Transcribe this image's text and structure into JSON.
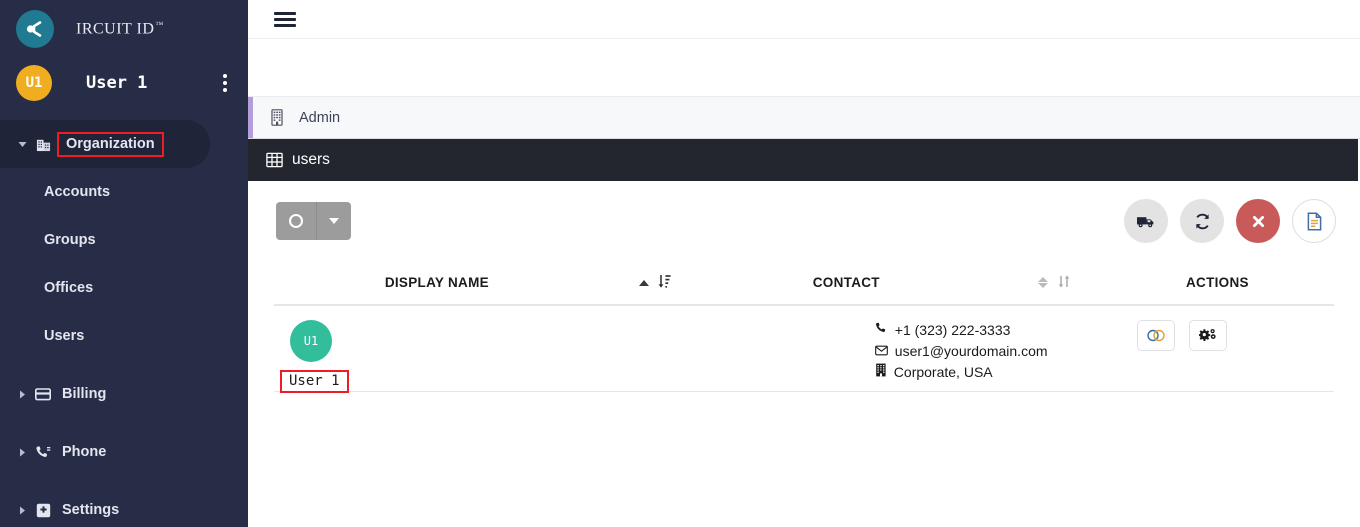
{
  "brand": {
    "name": "IRCUIT ID",
    "trademark": "™",
    "logo_icon": "circuit-logo-icon"
  },
  "sidebar": {
    "user": {
      "initials": "U1",
      "name": "User 1",
      "menu_icon": "kebab-menu-icon"
    },
    "items": [
      {
        "label": "Organization",
        "icon": "organization-icon",
        "expandable": true,
        "expanded": true,
        "active": true,
        "highlighted": true
      },
      {
        "label": "Accounts",
        "icon": "",
        "sub": true
      },
      {
        "label": "Groups",
        "icon": "",
        "sub": true
      },
      {
        "label": "Offices",
        "icon": "",
        "sub": true
      },
      {
        "label": "Users",
        "icon": "",
        "sub": true
      },
      {
        "label": "Billing",
        "icon": "credit-card-icon",
        "expandable": true,
        "expanded": false
      },
      {
        "label": "Phone",
        "icon": "phone-icon",
        "expandable": true,
        "expanded": false
      },
      {
        "label": "Settings",
        "icon": "settings-gear-icon",
        "expandable": true,
        "expanded": false
      }
    ]
  },
  "topbar": {
    "menu_toggle_icon": "hamburger-icon"
  },
  "breadcrumb": {
    "icon": "building-icon",
    "label": "Admin",
    "accent_color": "#b39ddb"
  },
  "panel": {
    "icon": "table-grid-icon",
    "title": "users"
  },
  "toolbar": {
    "split_button": {
      "main_icon": "circle-outline-icon",
      "caret_icon": "chevron-down-icon"
    },
    "actions": [
      {
        "name": "truck-icon",
        "style": "grey"
      },
      {
        "name": "refresh-icon",
        "style": "grey"
      },
      {
        "name": "close-x-icon",
        "style": "red"
      },
      {
        "name": "document-icon",
        "style": "white"
      }
    ],
    "accent_red": "#c85a5a"
  },
  "table": {
    "columns": [
      {
        "key": "display_name",
        "label": "DISPLAY NAME",
        "sort": "asc"
      },
      {
        "key": "contact",
        "label": "CONTACT",
        "sort": "none"
      },
      {
        "key": "actions",
        "label": "ACTIONS",
        "sort": null
      }
    ],
    "rows": [
      {
        "initials": "U1",
        "avatar_color": "#32bd9b",
        "display_name": "User 1",
        "phone": "+1 (323) 222-3333",
        "email": "user1@yourdomain.com",
        "office": "Corporate, USA",
        "phone_icon": "phone-icon",
        "email_icon": "envelope-icon",
        "office_icon": "building-icon",
        "row_actions": [
          {
            "name": "toggle-circles-icon"
          },
          {
            "name": "gears-icon"
          }
        ]
      }
    ]
  },
  "annotations": {
    "highlight_color": "#ee1c25"
  }
}
